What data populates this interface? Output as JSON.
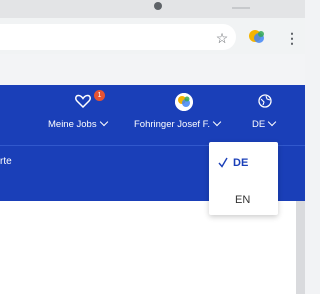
{
  "header": {
    "jobs_label": "Meine Jobs",
    "jobs_badge": "1",
    "user_name": "Fohringer Josef F.",
    "language": "DE"
  },
  "subnav": {
    "partial_text": "rte"
  },
  "language_menu": {
    "options": [
      {
        "label": "DE",
        "selected": true
      },
      {
        "label": "EN",
        "selected": false
      }
    ]
  },
  "colors": {
    "brand_blue": "#1a3fb8",
    "badge_orange": "#e55333"
  }
}
